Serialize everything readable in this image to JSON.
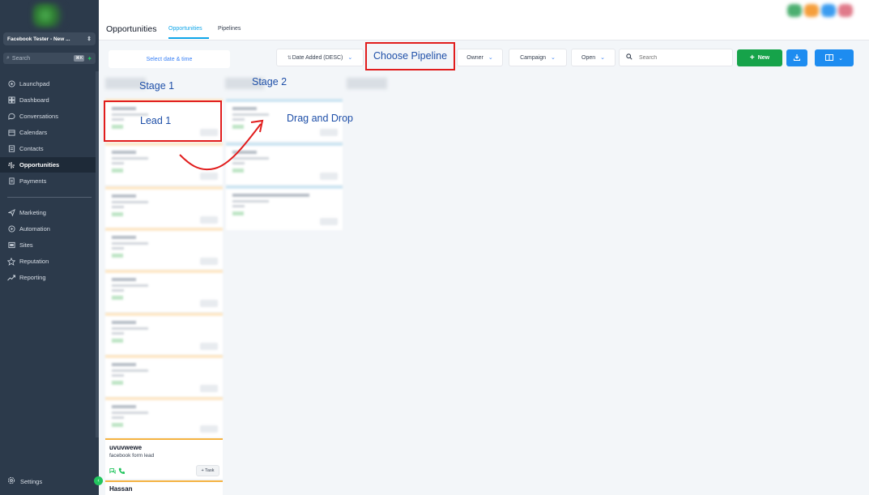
{
  "sidebar": {
    "account_name": "Facebook Tester - New ...",
    "search_placeholder": "Search",
    "search_shortcut": "⌘K",
    "items": [
      {
        "label": "Launchpad",
        "icon": "launchpad-icon"
      },
      {
        "label": "Dashboard",
        "icon": "dashboard-icon"
      },
      {
        "label": "Conversations",
        "icon": "chat-icon"
      },
      {
        "label": "Calendars",
        "icon": "calendar-icon"
      },
      {
        "label": "Contacts",
        "icon": "contacts-icon"
      },
      {
        "label": "Opportunities",
        "icon": "opportunities-icon",
        "active": true
      },
      {
        "label": "Payments",
        "icon": "payments-icon"
      },
      {
        "label": "Marketing",
        "icon": "send-icon"
      },
      {
        "label": "Automation",
        "icon": "automation-icon"
      },
      {
        "label": "Sites",
        "icon": "sites-icon"
      },
      {
        "label": "Reputation",
        "icon": "star-icon"
      },
      {
        "label": "Reporting",
        "icon": "trend-icon"
      }
    ],
    "settings_label": "Settings"
  },
  "header": {
    "title": "Opportunities",
    "tabs": [
      {
        "label": "Opportunities",
        "active": true
      },
      {
        "label": "Pipelines",
        "active": false
      }
    ]
  },
  "toolbar": {
    "date_range": "Select date & time",
    "sort_label": "Date Added (DESC)",
    "owner_label": "Owner",
    "campaign_label": "Campaign",
    "status_label": "Open",
    "search_placeholder": "Search",
    "new_label": "New"
  },
  "cards": [
    {
      "name": "uvuvwewe",
      "source": "facebook form lead",
      "task_label": "+ Task"
    },
    {
      "name": "Hassan"
    }
  ],
  "annotations": {
    "choose_pipeline": "Choose Pipeline",
    "stage1": "Stage 1",
    "stage2": "Stage 2",
    "lead1": "Lead 1",
    "drag_drop": "Drag and Drop"
  },
  "colors": {
    "sidebar_bg": "#2c3a4b",
    "accent_blue": "#1d8cf0",
    "new_green": "#16a34a",
    "annotation_red": "#e11d1d",
    "annotation_text": "#1e4fa8"
  }
}
